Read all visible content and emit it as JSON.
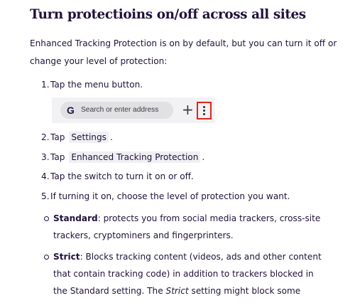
{
  "heading": "Turn protectioins on/off across all sites",
  "intro": "Enhanced Tracking Protection is on by default, but you can turn it off or change your level of protection:",
  "steps": [
    {
      "num": "1.",
      "text": "Tap the menu button."
    },
    {
      "num": "2.",
      "before": "Tap",
      "code": "Settings",
      "after": "."
    },
    {
      "num": "3.",
      "before": "Tap",
      "code": "Enhanced Tracking Protection",
      "after": "."
    },
    {
      "num": "4.",
      "text": "Tap the switch to turn it on or off."
    },
    {
      "num": "5.",
      "text": "If turning it on, choose the level of protection you want."
    }
  ],
  "toolbar_mock": {
    "google_glyph": "G",
    "address_placeholder": "Search or enter address",
    "new_tab_icon": "plus-icon",
    "menu_icon": "three-dot-menu-icon",
    "highlight_color": "#e0241b"
  },
  "levels": [
    {
      "name": "Standard",
      "text": ": protects you from social media trackers, cross-site trackers, cryptominers and fingerprinters."
    },
    {
      "name": "Strict",
      "text": ": Blocks tracking content (videos, ads and other content that contain tracking code) in addition to trackers blocked in the Standard setting. The ",
      "emph": "Strict",
      "text_after": " setting might block some website functionality."
    }
  ]
}
